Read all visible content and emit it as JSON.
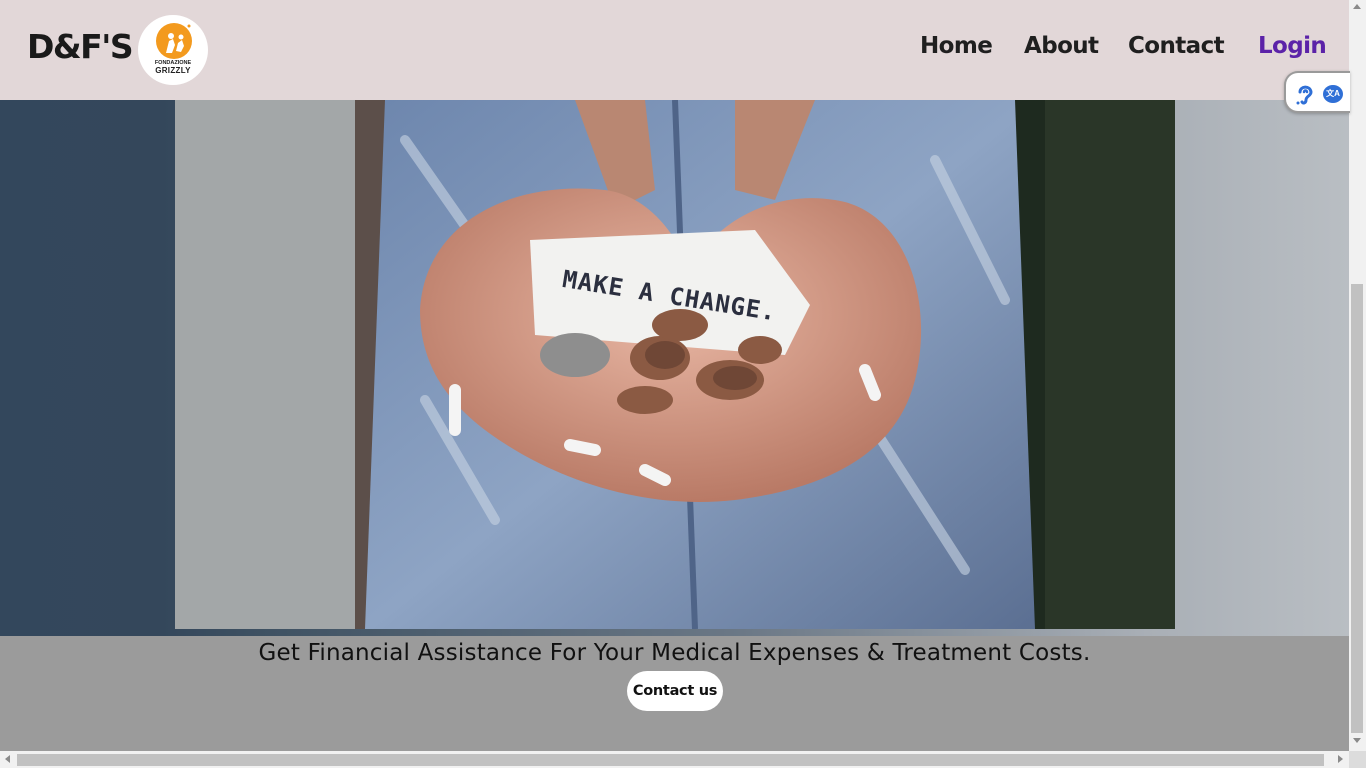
{
  "brand": {
    "name": "D&F'S",
    "logo_line1": "FONDAZIONE",
    "logo_line2": "GRIZZLY"
  },
  "nav": {
    "items": [
      {
        "label": "Home"
      },
      {
        "label": "About"
      },
      {
        "label": "Contact"
      },
      {
        "label": "Login"
      }
    ]
  },
  "hero": {
    "note_text": "MAKE A CHANGE."
  },
  "cta": {
    "tagline": "Get Financial Assistance For Your Medical Expenses & Treatment Costs.",
    "button_label": "Contact us"
  },
  "widget": {
    "icons": [
      "hearing-accessibility-icon",
      "translate-icon"
    ],
    "translate_glyph": "文A"
  },
  "colors": {
    "header_bg": "#e2d7d8",
    "login_accent": "#5b22a8",
    "band_bg": "#9b9b9b",
    "hero_left_bg": "#33475c",
    "logo_orange": "#f39a1e"
  }
}
